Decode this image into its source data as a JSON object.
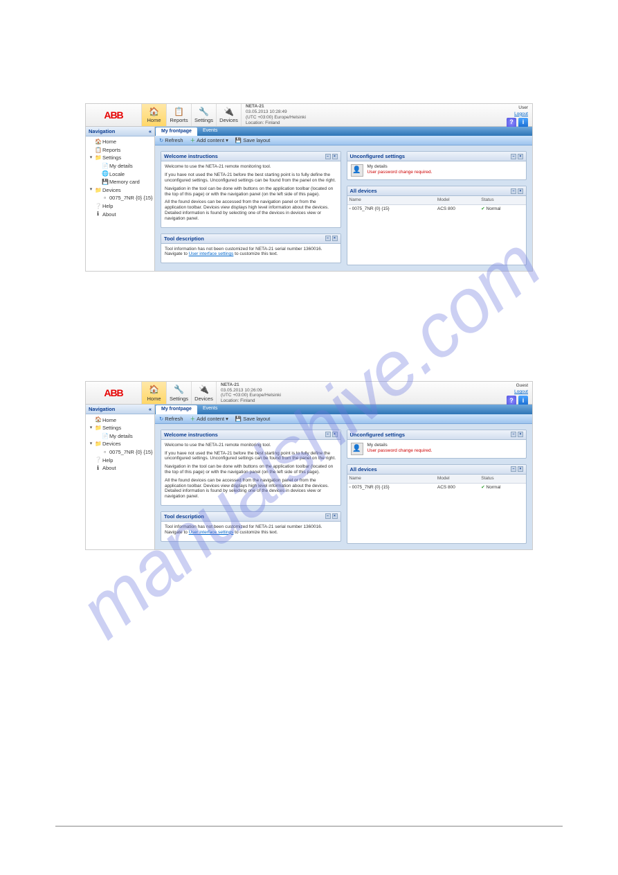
{
  "watermark": "manualshive.com",
  "common": {
    "brand": "ABB",
    "navigation_label": "Navigation",
    "nav_collapse": "«",
    "tabs": {
      "frontpage": "My frontpage",
      "events": "Events"
    },
    "toolbar": {
      "refresh": "Refresh",
      "add_content": "Add content",
      "save_layout": "Save layout"
    },
    "welcome": {
      "title": "Welcome instructions",
      "p1": "Welcome to use the NETA-21 remote monitoring tool.",
      "p2": "If you have not used the NETA-21 before the best starting point is to fully define the unconfigured settings. Unconfigured settings can be found from the panel on the right.",
      "p3": "Navigation in the tool can be done with buttons on the application toolbar (located on the top of this page) or with the navigation panel (on the left side of this page).",
      "p4": "All the found devices can be accessed from the navigation panel or from the application toolbar. Devices view displays high level information about the devices. Detailed information is found by selecting one of the devices in devices view or navigation panel."
    },
    "tool_desc": {
      "title": "Tool description",
      "text_prefix": "Tool information has not been customized for NETA-21 serial number 1360016. Navigate to ",
      "link": "User interface settings",
      "text_suffix": " to customize this text."
    },
    "unconf": {
      "title": "Unconfigured settings",
      "mydetails": "My details",
      "warning": "User password change required."
    },
    "alldev": {
      "title": "All devices",
      "cols": {
        "name": "Name",
        "model": "Model",
        "status": "Status"
      },
      "row": {
        "name": "0075_7NR {0} {15}",
        "model": "ACS 800",
        "status": "Normal"
      }
    }
  },
  "shot1": {
    "toolbar_btns": [
      {
        "label": "Home",
        "active": true
      },
      {
        "label": "Reports",
        "active": false
      },
      {
        "label": "Settings",
        "active": false
      },
      {
        "label": "Devices",
        "active": false
      }
    ],
    "header_info": {
      "title": "NETA-21",
      "time": "03.05.2013 10:28:49",
      "tz": "(UTC +03:00) Europe/Helsinki",
      "loc": "Location: Finland"
    },
    "user": {
      "role": "User",
      "logout": "Logout"
    },
    "tree": [
      {
        "level": 1,
        "icon": "🏠",
        "label": "Home",
        "tri": ""
      },
      {
        "level": 1,
        "icon": "📋",
        "label": "Reports",
        "tri": ""
      },
      {
        "level": 1,
        "icon": "📁",
        "label": "Settings",
        "tri": "▾"
      },
      {
        "level": 2,
        "icon": "📄",
        "label": "My details",
        "tri": ""
      },
      {
        "level": 2,
        "icon": "🌐",
        "label": "Locale",
        "tri": ""
      },
      {
        "level": 2,
        "icon": "💾",
        "label": "Memory card",
        "tri": ""
      },
      {
        "level": 1,
        "icon": "📁",
        "label": "Devices",
        "tri": "▾"
      },
      {
        "level": 2,
        "icon": "▫",
        "label": "0075_7NR {0} {15}",
        "tri": ""
      },
      {
        "level": 1,
        "icon": "❔",
        "label": "Help",
        "tri": ""
      },
      {
        "level": 1,
        "icon": "ℹ",
        "label": "About",
        "tri": ""
      }
    ]
  },
  "shot2": {
    "toolbar_btns": [
      {
        "label": "Home",
        "active": true
      },
      {
        "label": "Settings",
        "active": false
      },
      {
        "label": "Devices",
        "active": false
      }
    ],
    "header_info": {
      "title": "NETA-21",
      "time": "03.05.2013 10:26:09",
      "tz": "(UTC +03:00) Europe/Helsinki",
      "loc": "Location: Finland"
    },
    "user": {
      "role": "Guest",
      "logout": "Logout"
    },
    "tree": [
      {
        "level": 1,
        "icon": "🏠",
        "label": "Home",
        "tri": ""
      },
      {
        "level": 1,
        "icon": "📁",
        "label": "Settings",
        "tri": "▾"
      },
      {
        "level": 2,
        "icon": "📄",
        "label": "My details",
        "tri": ""
      },
      {
        "level": 1,
        "icon": "📁",
        "label": "Devices",
        "tri": "▾"
      },
      {
        "level": 2,
        "icon": "▫",
        "label": "0075_7NR {0} {15}",
        "tri": ""
      },
      {
        "level": 1,
        "icon": "❔",
        "label": "Help",
        "tri": ""
      },
      {
        "level": 1,
        "icon": "ℹ",
        "label": "About",
        "tri": ""
      }
    ]
  }
}
